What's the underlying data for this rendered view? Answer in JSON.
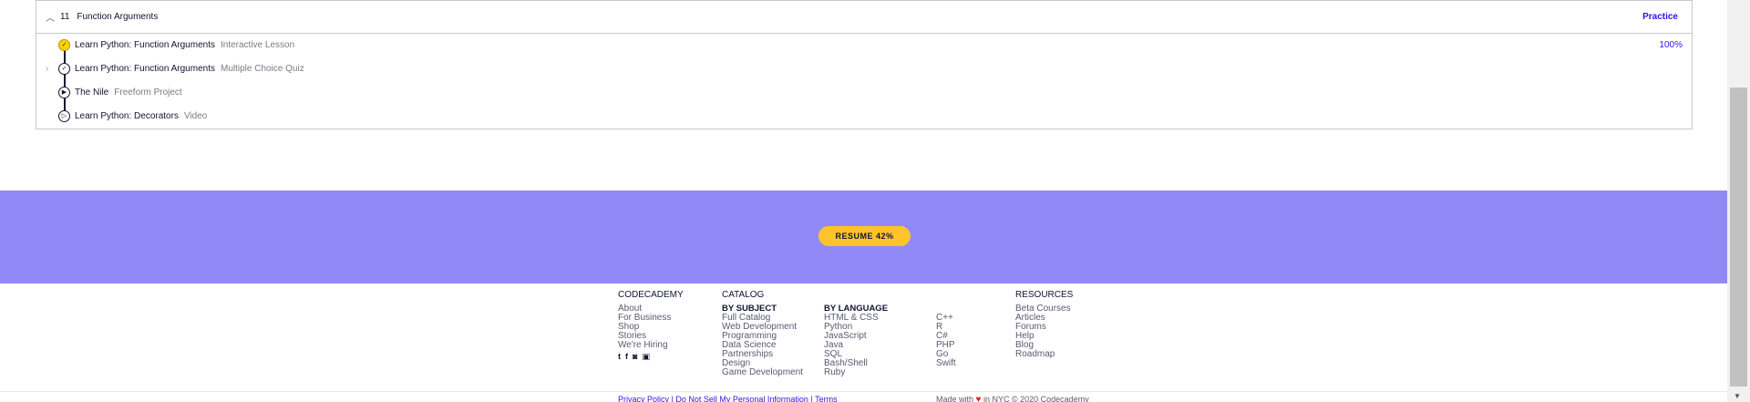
{
  "module": {
    "number": "11",
    "title": "Function Arguments",
    "practice_label": "Practice",
    "items": [
      {
        "name": "Learn Python: Function Arguments",
        "type": "Interactive Lesson",
        "progress": "100%",
        "node_glyph": "✓"
      },
      {
        "name": "Learn Python: Function Arguments",
        "type": "Multiple Choice Quiz",
        "node_glyph": "✓"
      },
      {
        "name": "The Nile",
        "type": "Freeform Project",
        "node_glyph": "▶"
      },
      {
        "name": "Learn Python: Decorators",
        "type": "Video",
        "node_glyph": "▷"
      }
    ]
  },
  "banner": {
    "resume_label": "RESUME 42%",
    "progress_percent": 42
  },
  "footer": {
    "codecademy": {
      "heading": "CODECADEMY",
      "links": [
        "About",
        "For Business",
        "Shop",
        "Stories",
        "We're Hiring"
      ]
    },
    "social_icons": [
      "twitter-icon",
      "facebook-icon",
      "instagram-icon",
      "youtube-icon"
    ],
    "catalog": {
      "heading": "CATALOG",
      "by_subject_heading": "BY SUBJECT",
      "subjects": [
        "Full Catalog",
        "Web Development",
        "Programming",
        "Data Science",
        "Partnerships",
        "Design",
        "Game Development"
      ],
      "by_language_heading": "BY LANGUAGE",
      "languages_col1": [
        "HTML & CSS",
        "Python",
        "JavaScript",
        "Java",
        "SQL",
        "Bash/Shell",
        "Ruby"
      ],
      "languages_col2": [
        "C++",
        "R",
        "C#",
        "PHP",
        "Go",
        "Swift"
      ]
    },
    "resources": {
      "heading": "RESOURCES",
      "links": [
        "Beta Courses",
        "Articles",
        "Forums",
        "Help",
        "Blog",
        "Roadmap"
      ]
    },
    "legal_text": "Privacy Policy | Do Not Sell My Personal Information | Terms",
    "made_with_prefix": "Made with",
    "made_with_suffix": "in NYC © 2020 Codecademy"
  },
  "colors": {
    "accent": "#3a10e5",
    "banner_bg": "#9189f6",
    "resume_button": "#ffc32b",
    "complete_node": "#ffd300",
    "heart": "#e02424"
  }
}
